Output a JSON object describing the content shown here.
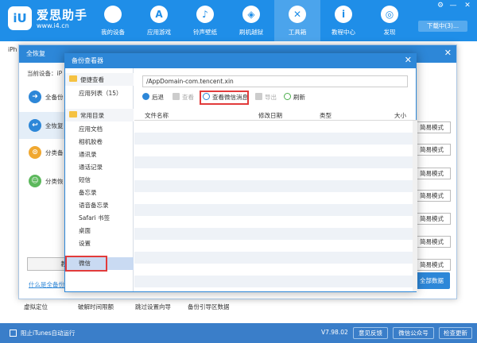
{
  "brand": {
    "logo_text": "iU",
    "name": "爱思助手",
    "url": "www.i4.cn"
  },
  "nav": [
    {
      "label": "我的设备",
      "glyph": ""
    },
    {
      "label": "应用游戏",
      "glyph": "A"
    },
    {
      "label": "铃声壁纸",
      "glyph": "♪"
    },
    {
      "label": "刷机越狱",
      "glyph": "◈"
    },
    {
      "label": "工具箱",
      "glyph": "✕"
    },
    {
      "label": "教程中心",
      "glyph": "i"
    },
    {
      "label": "发现",
      "glyph": "◎"
    }
  ],
  "window_controls": {
    "settings": "⚙",
    "minimize": "—",
    "close": "✕"
  },
  "download_button": "下载中(3)...",
  "device_tab": "iPh",
  "restore_dialog": {
    "title": "全恢复",
    "close": "✕",
    "current_device": "当前设备：iP",
    "options": [
      {
        "label": "全备份",
        "glyph": "➜",
        "color": "#2d87d8"
      },
      {
        "label": "全恢复",
        "glyph": "↩",
        "color": "#2d87d8"
      },
      {
        "label": "分类备",
        "glyph": "⊙",
        "color": "#f0a830"
      },
      {
        "label": "分类恢",
        "glyph": "☺",
        "color": "#5cb85c"
      }
    ],
    "left_button": "教程",
    "left_link": "什么是全备份",
    "mode_buttons": [
      "简易模式",
      "简易模式",
      "简易模式",
      "简易模式",
      "简易模式",
      "简易模式",
      "简易模式"
    ],
    "all_data_button": "全部数据"
  },
  "viewer": {
    "title": "备份查看器",
    "close": "✕",
    "groups": [
      {
        "label": "便捷查看",
        "items": [
          "应用列表（15）"
        ]
      },
      {
        "label": "常用目录",
        "items": [
          "应用文档",
          "相机胶卷",
          "通讯录",
          "通话记录",
          "短信",
          "备忘录",
          "语音备忘录",
          "Safari 书签",
          "桌面",
          "设置",
          "微信"
        ]
      }
    ],
    "path": "/AppDomain-com.tencent.xin",
    "toolbar": {
      "back": "后退",
      "view": "查看",
      "wechat": "查看微信消息",
      "export": "导出",
      "refresh": "刷新"
    },
    "columns": {
      "name": "文件名称",
      "date": "修改日期",
      "type": "类型",
      "size": "大小"
    }
  },
  "bottom_shortcuts": [
    "虚拟定位",
    "破解时间限额",
    "跳过设置向导",
    "备份引导区数据"
  ],
  "statusbar": {
    "itunes_label": "阻止iTunes自动运行",
    "version": "V7.98.02",
    "feedback": "意见反馈",
    "wechat_account": "微信公众号",
    "check_update": "检查更新"
  }
}
